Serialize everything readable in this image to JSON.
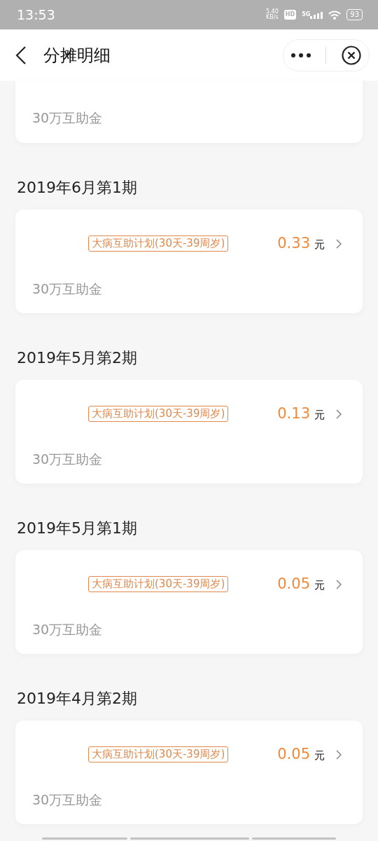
{
  "status_bar": {
    "time": "13:53",
    "net_speed": "5.40",
    "net_unit": "KB/s",
    "hd": "HD",
    "network": "5G",
    "battery": "93"
  },
  "header": {
    "title": "分摊明细"
  },
  "partial_card": {
    "note": "30万互助金"
  },
  "periods": [
    {
      "title": "2019年6月第1期",
      "tag": "大病互助计划(30天-39周岁)",
      "amount": "0.33",
      "unit": "元",
      "note": "30万互助金"
    },
    {
      "title": "2019年5月第2期",
      "tag": "大病互助计划(30天-39周岁)",
      "amount": "0.13",
      "unit": "元",
      "note": "30万互助金"
    },
    {
      "title": "2019年5月第1期",
      "tag": "大病互助计划(30天-39周岁)",
      "amount": "0.05",
      "unit": "元",
      "note": "30万互助金"
    },
    {
      "title": "2019年4月第2期",
      "tag": "大病互助计划(30天-39周岁)",
      "amount": "0.05",
      "unit": "元",
      "note": "30万互助金"
    }
  ]
}
